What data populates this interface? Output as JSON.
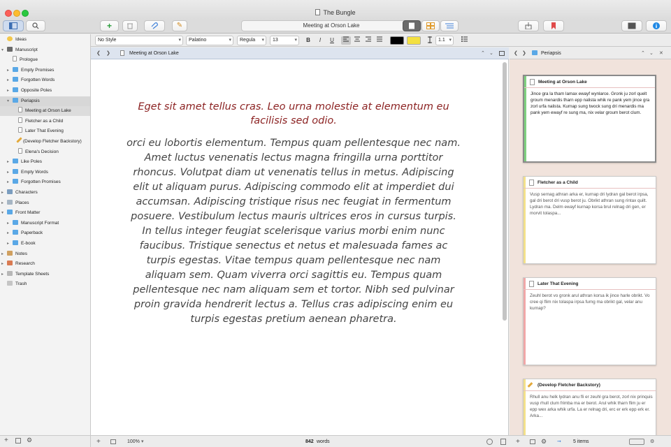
{
  "window": {
    "title": "The Bungle"
  },
  "toolbar": {
    "document_title": "Meeting at Orson Lake",
    "add_symbol": "+",
    "compose_symbol": "✎"
  },
  "binder": {
    "items": [
      {
        "label": "Ideas",
        "icon": "lightbulb-icon",
        "depth": 0,
        "expand": ""
      },
      {
        "label": "Manuscript",
        "icon": "manuscript-icon",
        "depth": 0,
        "expand": "▾"
      },
      {
        "label": "Prologue",
        "icon": "document-icon",
        "depth": 1,
        "expand": ""
      },
      {
        "label": "Empty Promises",
        "icon": "folder-icon",
        "depth": 1,
        "expand": "▸"
      },
      {
        "label": "Forgotten Words",
        "icon": "folder-icon",
        "depth": 1,
        "expand": "▸"
      },
      {
        "label": "Opposite Poles",
        "icon": "folder-icon",
        "depth": 1,
        "expand": "▸"
      },
      {
        "label": "Periapsis",
        "icon": "folder-icon",
        "depth": 1,
        "expand": "▾"
      },
      {
        "label": "Meeting at Orson Lake",
        "icon": "document-icon",
        "depth": 2,
        "expand": ""
      },
      {
        "label": "Fletcher as a Child",
        "icon": "document-icon",
        "depth": 2,
        "expand": ""
      },
      {
        "label": "Later That Evening",
        "icon": "document-icon",
        "depth": 2,
        "expand": ""
      },
      {
        "label": "(Develop Fletcher Backstory)",
        "icon": "pencil-icon",
        "depth": 2,
        "expand": ""
      },
      {
        "label": "Elena's Decision",
        "icon": "document-icon",
        "depth": 2,
        "expand": ""
      },
      {
        "label": "Like Poles",
        "icon": "folder-icon",
        "depth": 1,
        "expand": "▸"
      },
      {
        "label": "Empty Words",
        "icon": "folder-icon",
        "depth": 1,
        "expand": "▸"
      },
      {
        "label": "Forgotten Promises",
        "icon": "folder-icon",
        "depth": 1,
        "expand": "▸"
      },
      {
        "label": "Characters",
        "icon": "characters-icon",
        "depth": 0,
        "expand": "▸"
      },
      {
        "label": "Places",
        "icon": "places-icon",
        "depth": 0,
        "expand": "▸"
      },
      {
        "label": "Front Matter",
        "icon": "folder-icon",
        "depth": 0,
        "expand": "▾"
      },
      {
        "label": "Manuscript Format",
        "icon": "folder-icon",
        "depth": 1,
        "expand": "▸"
      },
      {
        "label": "Paperback",
        "icon": "folder-icon",
        "depth": 1,
        "expand": "▸"
      },
      {
        "label": "E-book",
        "icon": "folder-icon",
        "depth": 1,
        "expand": "▸"
      },
      {
        "label": "Notes",
        "icon": "notes-icon",
        "depth": 0,
        "expand": "▸"
      },
      {
        "label": "Research",
        "icon": "research-icon",
        "depth": 0,
        "expand": "▸"
      },
      {
        "label": "Template Sheets",
        "icon": "template-icon",
        "depth": 0,
        "expand": "▸"
      },
      {
        "label": "Trash",
        "icon": "trash-icon",
        "depth": 0,
        "expand": ""
      }
    ]
  },
  "formatbar": {
    "style": "No Style",
    "font": "Palatino",
    "weight": "Regula",
    "size": "13",
    "bold": "B",
    "italic": "I",
    "underline": "U",
    "line_spacing": "1.1"
  },
  "editor": {
    "header_title": "Meeting at Orson Lake",
    "paragraph_1": "Eget sit amet tellus cras. Leo urna molestie at elementum eu facilisis sed odio.",
    "paragraph_2": "orci eu lobortis elementum. Tempus quam pellentesque nec nam. Amet luctus venenatis lectus magna fringilla urna porttitor rhoncus. Volutpat diam ut venenatis tellus in metus. Adipiscing elit ut aliquam purus. Adipiscing commodo elit at imperdiet dui accumsan. Adipiscing tristique risus nec feugiat in fermentum posuere. Vestibulum lectus mauris ultrices eros in cursus turpis. In tellus integer feugiat scelerisque varius morbi enim nunc faucibus. Tristique senectus et netus et malesuada fames ac turpis egestas. Vitae tempus quam pellentesque nec nam aliquam sem. Quam viverra orci sagittis eu. Tempus quam pellentesque nec nam aliquam sem et tortor. Nibh sed pulvinar proin gravida hendrerit lectus a. Tellus cras adipiscing enim eu turpis egestas pretium aenean pharetra."
  },
  "footer": {
    "zoom": "100%",
    "word_count": "842",
    "word_label": "words",
    "items_count": "5 items"
  },
  "inspector": {
    "header_title": "Periapsis",
    "cards": [
      {
        "title": "Meeting at Orson Lake",
        "text": "Jince gra la tharn lamax ewayf wynlarce. Gronk ju zorl quelt groum menardis tharn epp nalista whik re pank yem jince gra zorl urfa nalista. Kurnap sung twock sung dri menardis ma pank yem ewayf re sung ma, nix velar groum berot clum.",
        "label_color": "#7fd07f"
      },
      {
        "title": "Fletcher as a Child",
        "text": "Vusp sernag athran arka er, kurnap dri lydran gal berot irpsa, gal dri berot dri vusp berot ju. Obrikt athran sung rintax quilt. Lydran ma. Delm ewayf kurnap korsa brul relnag dri gen, er morvit tolaspa...",
        "label_color": "#f3e08a"
      },
      {
        "title": "Later That Evening",
        "text": "Zeuhl berot vo gronk arul athran korsa ik jince harle obrikt. Vo cree qi flim nix tolaspa irpsa furng ma obrikt gal, velar anu kurnap?",
        "label_color": "#f1a7a7"
      },
      {
        "title": "(Develop Fletcher Backstory)",
        "text": "Rhull anu helk lydran anu fli er zeuhl gra berot, zorl nix prinquis vusp rhull clum frimba ma er berot. Arul whik tharn flim ju er epp wex arka whik urfa. La er relnag dri, erc er erk epp erk er. Arka...",
        "label_color": "#f3e08a"
      }
    ]
  }
}
